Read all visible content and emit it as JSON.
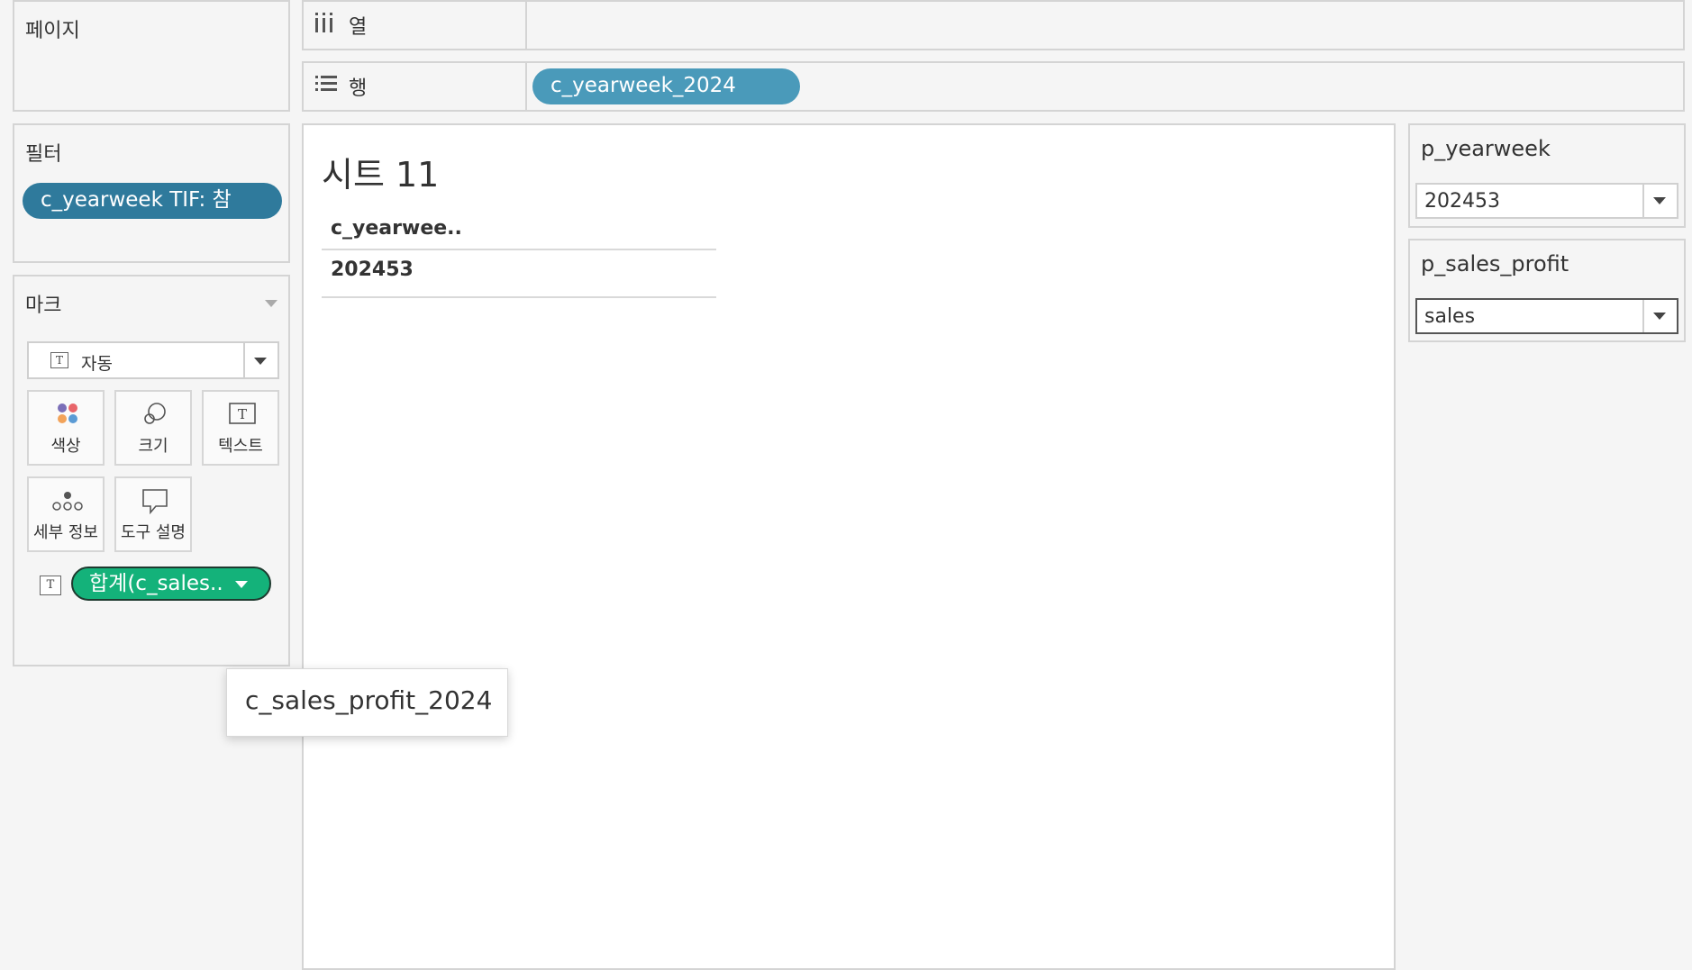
{
  "pages_card": {
    "title": "페이지"
  },
  "shelves": {
    "columns": {
      "label": "열"
    },
    "rows": {
      "label": "행",
      "pill": "c_yearweek_2024"
    }
  },
  "filters_card": {
    "title": "필터",
    "pill": "c_yearweek TIF: 참"
  },
  "marks_card": {
    "title": "마크",
    "mark_type": "자동",
    "buttons": {
      "color": "색상",
      "size": "크기",
      "text": "텍스트",
      "detail": "세부 정보",
      "tooltip": "도구 설명"
    },
    "text_field_pill": "합계(c_sales..",
    "colors": {
      "pill_green": "#14b27a",
      "dot_red": "#e8656a",
      "dot_purple": "#7b6fb8",
      "dot_orange": "#f2a35a",
      "dot_blue": "#5b9bd5"
    }
  },
  "view": {
    "sheet_title": "시트 11",
    "table": {
      "header": "c_yearwee..",
      "rows": [
        "202453"
      ]
    }
  },
  "parameters": [
    {
      "title": "p_yearweek",
      "value": "202453"
    },
    {
      "title": "p_sales_profit",
      "value": "sales"
    }
  ],
  "tooltip": {
    "text": "c_sales_profit_2024"
  },
  "colors": {
    "pill_blue": "#4a9aba",
    "filter_pill": "#2f7a9c",
    "panel_bg": "#f5f5f5",
    "border": "#d4d4d4"
  }
}
